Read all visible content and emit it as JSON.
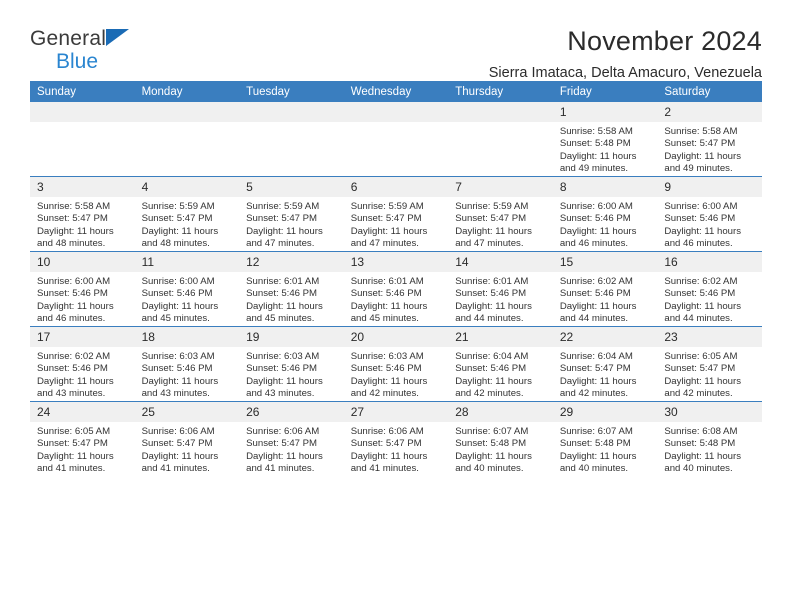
{
  "brand": {
    "name_top": "General",
    "name_bottom": "Blue",
    "triangle_color": "#1a6bb5",
    "blue_color": "#2a85d0"
  },
  "header": {
    "title": "November 2024",
    "subtitle": "Sierra Imataca, Delta Amacuro, Venezuela"
  },
  "theme": {
    "header_bg": "#3a7ebf",
    "daynum_bg": "#f0f0f0",
    "grid_line": "#3a7ebf",
    "text": "#2b2b2b"
  },
  "weekdays": [
    "Sunday",
    "Monday",
    "Tuesday",
    "Wednesday",
    "Thursday",
    "Friday",
    "Saturday"
  ],
  "weeks": [
    [
      {
        "day": "",
        "sunrise": "",
        "sunset": "",
        "daylight1": "",
        "daylight2": ""
      },
      {
        "day": "",
        "sunrise": "",
        "sunset": "",
        "daylight1": "",
        "daylight2": ""
      },
      {
        "day": "",
        "sunrise": "",
        "sunset": "",
        "daylight1": "",
        "daylight2": ""
      },
      {
        "day": "",
        "sunrise": "",
        "sunset": "",
        "daylight1": "",
        "daylight2": ""
      },
      {
        "day": "",
        "sunrise": "",
        "sunset": "",
        "daylight1": "",
        "daylight2": ""
      },
      {
        "day": "1",
        "sunrise": "Sunrise: 5:58 AM",
        "sunset": "Sunset: 5:48 PM",
        "daylight1": "Daylight: 11 hours",
        "daylight2": "and 49 minutes."
      },
      {
        "day": "2",
        "sunrise": "Sunrise: 5:58 AM",
        "sunset": "Sunset: 5:47 PM",
        "daylight1": "Daylight: 11 hours",
        "daylight2": "and 49 minutes."
      }
    ],
    [
      {
        "day": "3",
        "sunrise": "Sunrise: 5:58 AM",
        "sunset": "Sunset: 5:47 PM",
        "daylight1": "Daylight: 11 hours",
        "daylight2": "and 48 minutes."
      },
      {
        "day": "4",
        "sunrise": "Sunrise: 5:59 AM",
        "sunset": "Sunset: 5:47 PM",
        "daylight1": "Daylight: 11 hours",
        "daylight2": "and 48 minutes."
      },
      {
        "day": "5",
        "sunrise": "Sunrise: 5:59 AM",
        "sunset": "Sunset: 5:47 PM",
        "daylight1": "Daylight: 11 hours",
        "daylight2": "and 47 minutes."
      },
      {
        "day": "6",
        "sunrise": "Sunrise: 5:59 AM",
        "sunset": "Sunset: 5:47 PM",
        "daylight1": "Daylight: 11 hours",
        "daylight2": "and 47 minutes."
      },
      {
        "day": "7",
        "sunrise": "Sunrise: 5:59 AM",
        "sunset": "Sunset: 5:47 PM",
        "daylight1": "Daylight: 11 hours",
        "daylight2": "and 47 minutes."
      },
      {
        "day": "8",
        "sunrise": "Sunrise: 6:00 AM",
        "sunset": "Sunset: 5:46 PM",
        "daylight1": "Daylight: 11 hours",
        "daylight2": "and 46 minutes."
      },
      {
        "day": "9",
        "sunrise": "Sunrise: 6:00 AM",
        "sunset": "Sunset: 5:46 PM",
        "daylight1": "Daylight: 11 hours",
        "daylight2": "and 46 minutes."
      }
    ],
    [
      {
        "day": "10",
        "sunrise": "Sunrise: 6:00 AM",
        "sunset": "Sunset: 5:46 PM",
        "daylight1": "Daylight: 11 hours",
        "daylight2": "and 46 minutes."
      },
      {
        "day": "11",
        "sunrise": "Sunrise: 6:00 AM",
        "sunset": "Sunset: 5:46 PM",
        "daylight1": "Daylight: 11 hours",
        "daylight2": "and 45 minutes."
      },
      {
        "day": "12",
        "sunrise": "Sunrise: 6:01 AM",
        "sunset": "Sunset: 5:46 PM",
        "daylight1": "Daylight: 11 hours",
        "daylight2": "and 45 minutes."
      },
      {
        "day": "13",
        "sunrise": "Sunrise: 6:01 AM",
        "sunset": "Sunset: 5:46 PM",
        "daylight1": "Daylight: 11 hours",
        "daylight2": "and 45 minutes."
      },
      {
        "day": "14",
        "sunrise": "Sunrise: 6:01 AM",
        "sunset": "Sunset: 5:46 PM",
        "daylight1": "Daylight: 11 hours",
        "daylight2": "and 44 minutes."
      },
      {
        "day": "15",
        "sunrise": "Sunrise: 6:02 AM",
        "sunset": "Sunset: 5:46 PM",
        "daylight1": "Daylight: 11 hours",
        "daylight2": "and 44 minutes."
      },
      {
        "day": "16",
        "sunrise": "Sunrise: 6:02 AM",
        "sunset": "Sunset: 5:46 PM",
        "daylight1": "Daylight: 11 hours",
        "daylight2": "and 44 minutes."
      }
    ],
    [
      {
        "day": "17",
        "sunrise": "Sunrise: 6:02 AM",
        "sunset": "Sunset: 5:46 PM",
        "daylight1": "Daylight: 11 hours",
        "daylight2": "and 43 minutes."
      },
      {
        "day": "18",
        "sunrise": "Sunrise: 6:03 AM",
        "sunset": "Sunset: 5:46 PM",
        "daylight1": "Daylight: 11 hours",
        "daylight2": "and 43 minutes."
      },
      {
        "day": "19",
        "sunrise": "Sunrise: 6:03 AM",
        "sunset": "Sunset: 5:46 PM",
        "daylight1": "Daylight: 11 hours",
        "daylight2": "and 43 minutes."
      },
      {
        "day": "20",
        "sunrise": "Sunrise: 6:03 AM",
        "sunset": "Sunset: 5:46 PM",
        "daylight1": "Daylight: 11 hours",
        "daylight2": "and 42 minutes."
      },
      {
        "day": "21",
        "sunrise": "Sunrise: 6:04 AM",
        "sunset": "Sunset: 5:46 PM",
        "daylight1": "Daylight: 11 hours",
        "daylight2": "and 42 minutes."
      },
      {
        "day": "22",
        "sunrise": "Sunrise: 6:04 AM",
        "sunset": "Sunset: 5:47 PM",
        "daylight1": "Daylight: 11 hours",
        "daylight2": "and 42 minutes."
      },
      {
        "day": "23",
        "sunrise": "Sunrise: 6:05 AM",
        "sunset": "Sunset: 5:47 PM",
        "daylight1": "Daylight: 11 hours",
        "daylight2": "and 42 minutes."
      }
    ],
    [
      {
        "day": "24",
        "sunrise": "Sunrise: 6:05 AM",
        "sunset": "Sunset: 5:47 PM",
        "daylight1": "Daylight: 11 hours",
        "daylight2": "and 41 minutes."
      },
      {
        "day": "25",
        "sunrise": "Sunrise: 6:06 AM",
        "sunset": "Sunset: 5:47 PM",
        "daylight1": "Daylight: 11 hours",
        "daylight2": "and 41 minutes."
      },
      {
        "day": "26",
        "sunrise": "Sunrise: 6:06 AM",
        "sunset": "Sunset: 5:47 PM",
        "daylight1": "Daylight: 11 hours",
        "daylight2": "and 41 minutes."
      },
      {
        "day": "27",
        "sunrise": "Sunrise: 6:06 AM",
        "sunset": "Sunset: 5:47 PM",
        "daylight1": "Daylight: 11 hours",
        "daylight2": "and 41 minutes."
      },
      {
        "day": "28",
        "sunrise": "Sunrise: 6:07 AM",
        "sunset": "Sunset: 5:48 PM",
        "daylight1": "Daylight: 11 hours",
        "daylight2": "and 40 minutes."
      },
      {
        "day": "29",
        "sunrise": "Sunrise: 6:07 AM",
        "sunset": "Sunset: 5:48 PM",
        "daylight1": "Daylight: 11 hours",
        "daylight2": "and 40 minutes."
      },
      {
        "day": "30",
        "sunrise": "Sunrise: 6:08 AM",
        "sunset": "Sunset: 5:48 PM",
        "daylight1": "Daylight: 11 hours",
        "daylight2": "and 40 minutes."
      }
    ]
  ]
}
